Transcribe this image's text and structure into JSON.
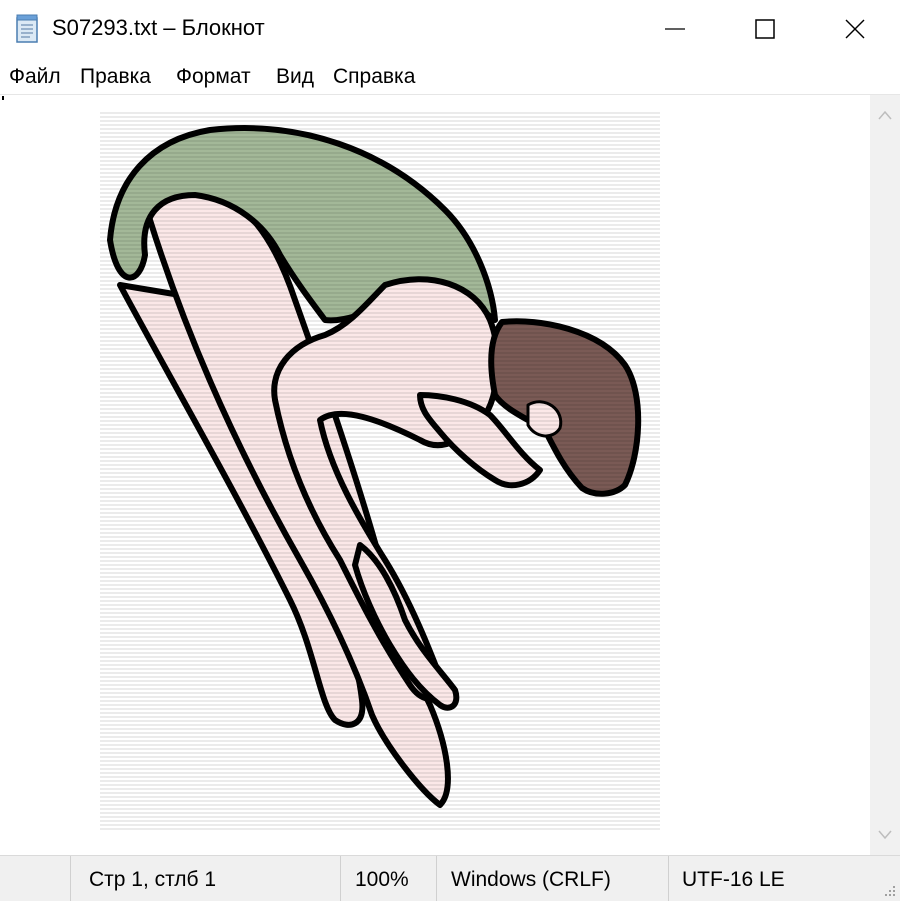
{
  "window": {
    "title": "S07293.txt – Блокнот"
  },
  "controls": {
    "minimize": "minimize",
    "maximize": "maximize",
    "close": "close"
  },
  "menu": {
    "items": [
      "Файл",
      "Правка",
      "Формат",
      "Вид",
      "Справка"
    ]
  },
  "status": {
    "position": "Стр 1, стлб 1",
    "zoom": "100%",
    "line_endings": "Windows (CRLF)",
    "encoding": "UTF-16 LE"
  },
  "colors": {
    "outline": "#000000",
    "skin": "#fbe8e8",
    "leotard": "#a3b898",
    "hair": "#7a5a55"
  }
}
